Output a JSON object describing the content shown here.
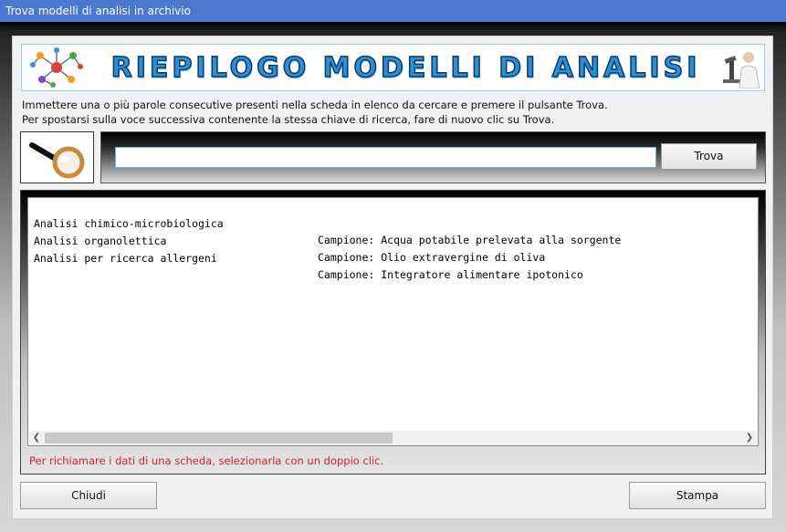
{
  "window": {
    "title": "Trova modelli di analisi in archivio"
  },
  "banner": {
    "title": "RIEPILOGO MODELLI DI ANALISI"
  },
  "instructions": {
    "line1": "Immettere una o più parole consecutive presenti nella scheda in elenco da cercare e premere il pulsante Trova.",
    "line2": "Per spostarsi sulla voce successiva contenente la stessa chiave di ricerca, fare di nuovo clic su Trova."
  },
  "search": {
    "value": "",
    "button_label": "Trova"
  },
  "list": {
    "rows": [
      {
        "name": "Analisi chimico-microbiologica",
        "sample": "Campione: Acqua potabile prelevata alla sorgente"
      },
      {
        "name": "Analisi organolettica",
        "sample": "Campione: Olio extravergine di oliva"
      },
      {
        "name": "Analisi per ricerca allergeni",
        "sample": "Campione: Integratore alimentare ipotonico"
      }
    ]
  },
  "hint": "Per richiamare i dati di una scheda, selezionarla con un doppio clic.",
  "footer": {
    "close_label": "Chiudi",
    "print_label": "Stampa"
  },
  "colors": {
    "titlebar": "#4a78cf",
    "hint": "#cc2233",
    "banner_text": "#2e8fd4"
  },
  "icons": {
    "banner_left": "molecule-icon",
    "banner_right": "scientist-microscope-icon",
    "search": "magnifying-glass-icon"
  }
}
